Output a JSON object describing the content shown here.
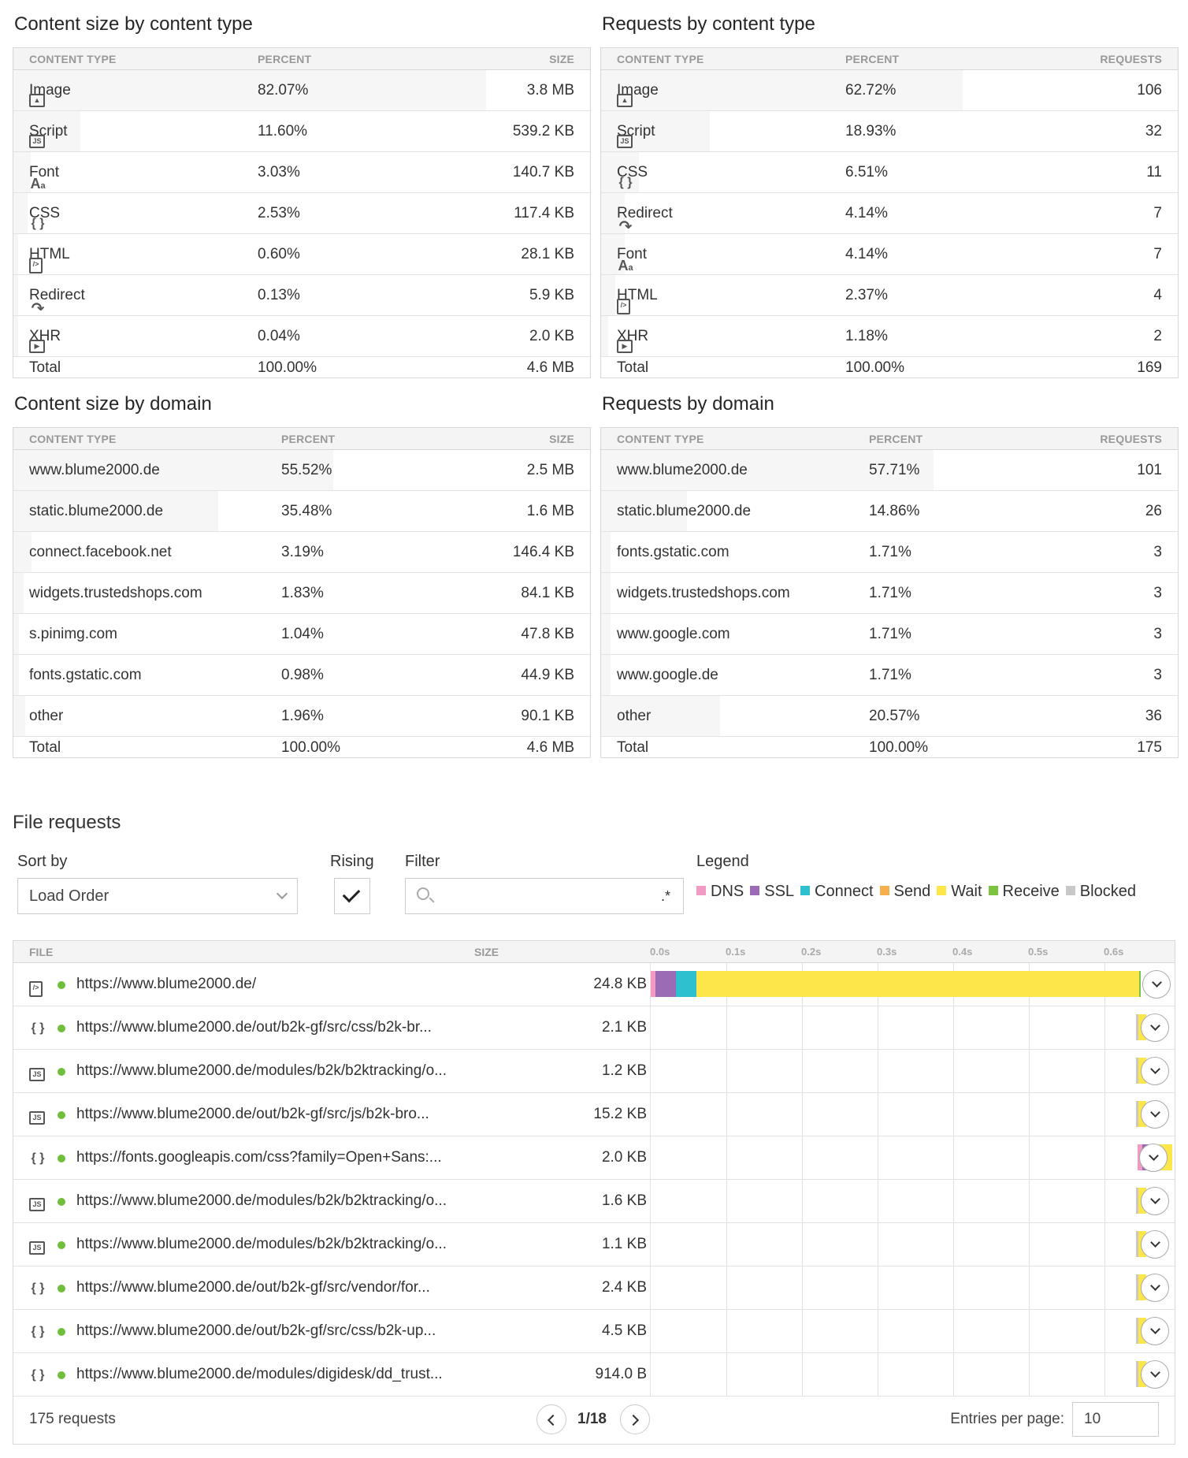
{
  "panels": {
    "size_by_type": {
      "title": "Content size by content type",
      "headers": [
        "CONTENT TYPE",
        "PERCENT",
        "SIZE"
      ],
      "rows": [
        {
          "icon": "image-icon",
          "name": "Image",
          "percent": "82.07%",
          "value": "3.8 MB",
          "fill": 0.82
        },
        {
          "icon": "script-icon",
          "name": "Script",
          "percent": "11.60%",
          "value": "539.2 KB",
          "fill": 0.116
        },
        {
          "icon": "font-icon",
          "name": "Font",
          "percent": "3.03%",
          "value": "140.7 KB",
          "fill": 0.03
        },
        {
          "icon": "css-icon",
          "name": "CSS",
          "percent": "2.53%",
          "value": "117.4 KB",
          "fill": 0.025
        },
        {
          "icon": "html-icon",
          "name": "HTML",
          "percent": "0.60%",
          "value": "28.1 KB",
          "fill": 0.006
        },
        {
          "icon": "redirect-icon",
          "name": "Redirect",
          "percent": "0.13%",
          "value": "5.9 KB",
          "fill": 0.001
        },
        {
          "icon": "xhr-icon",
          "name": "XHR",
          "percent": "0.04%",
          "value": "2.0 KB",
          "fill": 0.0004
        }
      ],
      "total": {
        "label": "Total",
        "percent": "100.00%",
        "value": "4.6 MB"
      }
    },
    "requests_by_type": {
      "title": "Requests by content type",
      "headers": [
        "CONTENT TYPE",
        "PERCENT",
        "REQUESTS"
      ],
      "rows": [
        {
          "icon": "image-icon",
          "name": "Image",
          "percent": "62.72%",
          "value": "106",
          "fill": 0.627
        },
        {
          "icon": "script-icon",
          "name": "Script",
          "percent": "18.93%",
          "value": "32",
          "fill": 0.189
        },
        {
          "icon": "css-icon",
          "name": "CSS",
          "percent": "6.51%",
          "value": "11",
          "fill": 0.065
        },
        {
          "icon": "redirect-icon",
          "name": "Redirect",
          "percent": "4.14%",
          "value": "7",
          "fill": 0.041
        },
        {
          "icon": "font-icon",
          "name": "Font",
          "percent": "4.14%",
          "value": "7",
          "fill": 0.041
        },
        {
          "icon": "html-icon",
          "name": "HTML",
          "percent": "2.37%",
          "value": "4",
          "fill": 0.024
        },
        {
          "icon": "xhr-icon",
          "name": "XHR",
          "percent": "1.18%",
          "value": "2",
          "fill": 0.012
        }
      ],
      "total": {
        "label": "Total",
        "percent": "100.00%",
        "value": "169"
      }
    },
    "size_by_domain": {
      "title": "Content size by domain",
      "headers": [
        "CONTENT TYPE",
        "PERCENT",
        "SIZE"
      ],
      "rows": [
        {
          "name": "www.blume2000.de",
          "percent": "55.52%",
          "value": "2.5 MB",
          "fill": 0.555
        },
        {
          "name": "static.blume2000.de",
          "percent": "35.48%",
          "value": "1.6 MB",
          "fill": 0.355
        },
        {
          "name": "connect.facebook.net",
          "percent": "3.19%",
          "value": "146.4 KB",
          "fill": 0.032
        },
        {
          "name": "widgets.trustedshops.com",
          "percent": "1.83%",
          "value": "84.1 KB",
          "fill": 0.018
        },
        {
          "name": "s.pinimg.com",
          "percent": "1.04%",
          "value": "47.8 KB",
          "fill": 0.01
        },
        {
          "name": "fonts.gstatic.com",
          "percent": "0.98%",
          "value": "44.9 KB",
          "fill": 0.01
        },
        {
          "name": "other",
          "percent": "1.96%",
          "value": "90.1 KB",
          "fill": 0.02
        }
      ],
      "total": {
        "label": "Total",
        "percent": "100.00%",
        "value": "4.6 MB"
      }
    },
    "requests_by_domain": {
      "title": "Requests by domain",
      "headers": [
        "CONTENT TYPE",
        "PERCENT",
        "REQUESTS"
      ],
      "rows": [
        {
          "name": "www.blume2000.de",
          "percent": "57.71%",
          "value": "101",
          "fill": 0.577
        },
        {
          "name": "static.blume2000.de",
          "percent": "14.86%",
          "value": "26",
          "fill": 0.149
        },
        {
          "name": "fonts.gstatic.com",
          "percent": "1.71%",
          "value": "3",
          "fill": 0.017
        },
        {
          "name": "widgets.trustedshops.com",
          "percent": "1.71%",
          "value": "3",
          "fill": 0.017
        },
        {
          "name": "www.google.com",
          "percent": "1.71%",
          "value": "3",
          "fill": 0.017
        },
        {
          "name": "www.google.de",
          "percent": "1.71%",
          "value": "3",
          "fill": 0.017
        },
        {
          "name": "other",
          "percent": "20.57%",
          "value": "36",
          "fill": 0.206
        }
      ],
      "total": {
        "label": "Total",
        "percent": "100.00%",
        "value": "175"
      }
    }
  },
  "file_requests": {
    "title": "File requests",
    "sort_label": "Sort by",
    "sort_value": "Load Order",
    "rising_label": "Rising",
    "filter_label": "Filter",
    "filter_placeholder": "",
    "regex_symbol": ".*",
    "legend_label": "Legend",
    "legend": [
      {
        "name": "DNS",
        "color": "#f29ac4"
      },
      {
        "name": "SSL",
        "color": "#9b6bb5"
      },
      {
        "name": "Connect",
        "color": "#2fc0d0"
      },
      {
        "name": "Send",
        "color": "#f5b04d"
      },
      {
        "name": "Wait",
        "color": "#fce64a"
      },
      {
        "name": "Receive",
        "color": "#7cc43f"
      },
      {
        "name": "Blocked",
        "color": "#c8c8c8"
      }
    ],
    "headers": {
      "file": "FILE",
      "size": "SIZE"
    },
    "ticks": [
      "0.0s",
      "0.1s",
      "0.2s",
      "0.3s",
      "0.4s",
      "0.5s",
      "0.6s"
    ],
    "rows": [
      {
        "icon": "html-icon",
        "url": "https://www.blume2000.de/",
        "size": "24.8 KB"
      },
      {
        "icon": "css-icon",
        "url": "https://www.blume2000.de/out/b2k-gf/src/css/b2k-br...",
        "size": "2.1 KB"
      },
      {
        "icon": "script-icon",
        "url": "https://www.blume2000.de/modules/b2k/b2ktracking/o...",
        "size": "1.2 KB"
      },
      {
        "icon": "script-icon",
        "url": "https://www.blume2000.de/out/b2k-gf/src/js/b2k-bro...",
        "size": "15.2 KB"
      },
      {
        "icon": "css-icon",
        "url": "https://fonts.googleapis.com/css?family=Open+Sans:...",
        "size": "2.0 KB"
      },
      {
        "icon": "script-icon",
        "url": "https://www.blume2000.de/modules/b2k/b2ktracking/o...",
        "size": "1.6 KB"
      },
      {
        "icon": "script-icon",
        "url": "https://www.blume2000.de/modules/b2k/b2ktracking/o...",
        "size": "1.1 KB"
      },
      {
        "icon": "css-icon",
        "url": "https://www.blume2000.de/out/b2k-gf/src/vendor/for...",
        "size": "2.4 KB"
      },
      {
        "icon": "css-icon",
        "url": "https://www.blume2000.de/out/b2k-gf/src/css/b2k-up...",
        "size": "4.5 KB"
      },
      {
        "icon": "css-icon",
        "url": "https://www.blume2000.de/modules/digidesk/dd_trust...",
        "size": "914.0 B"
      }
    ],
    "request_count": "175 requests",
    "page": "1/18",
    "entries_label": "Entries per page:",
    "entries_value": "10"
  }
}
